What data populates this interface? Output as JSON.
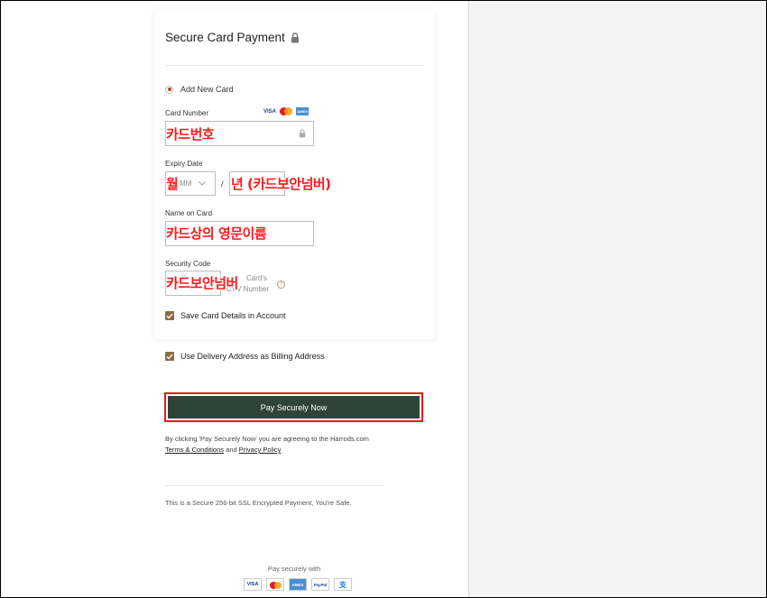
{
  "payment": {
    "title": "Secure Card Payment",
    "add_new_card": "Add New Card",
    "card_number_label": "Card Number",
    "expiry_label": "Expiry Date",
    "month_placeholder": "MM",
    "slash": "/",
    "name_label": "Name on Card",
    "security_label": "Security Code",
    "security_hint_line1": "Card's",
    "security_hint_line2": "CVV Number",
    "save_card": "Save Card Details in Account"
  },
  "brands": {
    "visa": "VISA",
    "amex": "AMEX"
  },
  "overlays": {
    "card_number": "카드번호",
    "month": "월",
    "year": "년 (카드보안넘버)",
    "name": "카드상의 영문이름",
    "security": "카드보안넘버"
  },
  "billing": {
    "use_delivery": "Use Delivery Address as Billing Address"
  },
  "pay_button": {
    "label": "Pay Securely Now"
  },
  "terms": {
    "text": "By clicking 'Pay Securely Now' you are agreeing to the Harrods.com",
    "terms_link": "Terms & Conditions",
    "and": "and",
    "privacy_link": "Privacy Policy"
  },
  "ssl_note": "This is a Secure 256-bit SSL Encrypted Payment, You're Safe.",
  "footer": {
    "pay_securely_with": "Pay securely with",
    "logos": [
      "VISA",
      "AMEX",
      "PayPal",
      "支"
    ]
  },
  "colors": {
    "button_bg": "#2f4434",
    "checkbox": "#8b6d46",
    "annotation_red": "#ff1a1a",
    "radio_dot": "#a94c3c"
  }
}
